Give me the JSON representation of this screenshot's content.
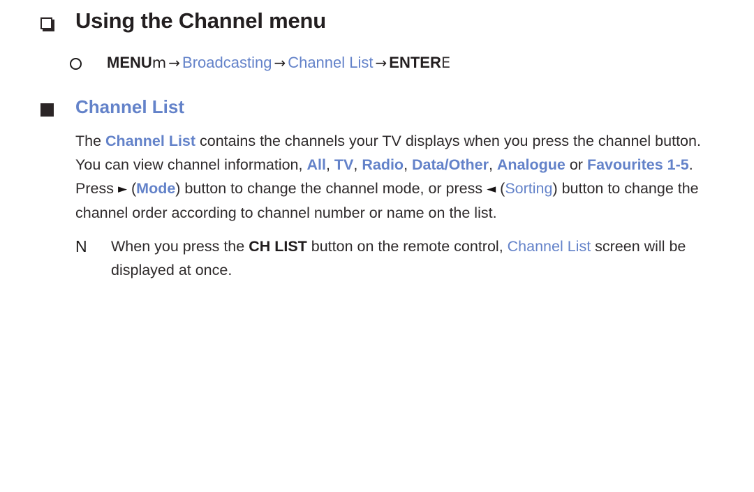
{
  "page": {
    "background": "#ffffff",
    "accent_blue": "#6382c9",
    "text_color": "#2e2a2b"
  },
  "title": {
    "bullet_icon": "hollow-square-icon",
    "text": "Using the Channel menu"
  },
  "menu_path": {
    "bullet_icon": "circle-outline-icon",
    "items": [
      {
        "label": "MENU",
        "style": "bold-black"
      },
      {
        "label": "m",
        "style": "symbol-black"
      },
      {
        "label": "→",
        "style": "arrow"
      },
      {
        "label": "Broadcasting",
        "style": "blue"
      },
      {
        "label": "→",
        "style": "arrow"
      },
      {
        "label": "Channel List",
        "style": "blue"
      },
      {
        "label": "→",
        "style": "arrow"
      },
      {
        "label": "ENTER",
        "style": "bold-black"
      },
      {
        "label": "E",
        "style": "symbol-gray"
      }
    ]
  },
  "section": {
    "bullet_icon": "filled-square-icon",
    "heading": "Channel List"
  },
  "paragraphs": [
    {
      "id": "channel-list-description",
      "runs": [
        {
          "t": "The ",
          "s": "plain"
        },
        {
          "t": "Channel List",
          "s": "blue-bold"
        },
        {
          "t": " contains the channels your TV displays when you press the channel button. You can view channel information, ",
          "s": "plain"
        },
        {
          "t": "All",
          "s": "blue-bold"
        },
        {
          "t": ", ",
          "s": "plain"
        },
        {
          "t": "TV",
          "s": "blue-bold"
        },
        {
          "t": ", ",
          "s": "plain"
        },
        {
          "t": "Radio",
          "s": "blue-bold"
        },
        {
          "t": ", ",
          "s": "plain"
        },
        {
          "t": "Data/Other",
          "s": "blue-bold"
        },
        {
          "t": ", ",
          "s": "plain"
        },
        {
          "t": "Analogue",
          "s": "blue-bold"
        },
        {
          "t": " or ",
          "s": "plain"
        },
        {
          "t": "Favourites 1-5",
          "s": "blue-bold"
        },
        {
          "t": ".",
          "s": "plain"
        }
      ]
    },
    {
      "id": "mode-sorting-description",
      "runs": [
        {
          "t": "Press ",
          "s": "plain"
        },
        {
          "t": "►",
          "s": "triangle"
        },
        {
          "t": " (",
          "s": "plain"
        },
        {
          "t": "Mode",
          "s": "blue-bold"
        },
        {
          "t": ") button to change the channel mode, or press ",
          "s": "plain"
        },
        {
          "t": "◄",
          "s": "triangle"
        },
        {
          "t": " (",
          "s": "plain"
        },
        {
          "t": "Sorting",
          "s": "blue"
        },
        {
          "t": ") button to change the channel order according to channel number or name on the list.",
          "s": "plain"
        }
      ]
    }
  ],
  "note": {
    "glyph": "N",
    "glyph_icon": "note-n-icon",
    "runs": [
      {
        "t": "When you press the ",
        "s": "plain"
      },
      {
        "t": "CH LIST",
        "s": "bold"
      },
      {
        "t": " button on the remote control, ",
        "s": "plain"
      },
      {
        "t": "Channel List",
        "s": "blue"
      },
      {
        "t": " screen will be displayed at once.",
        "s": "plain"
      }
    ]
  }
}
